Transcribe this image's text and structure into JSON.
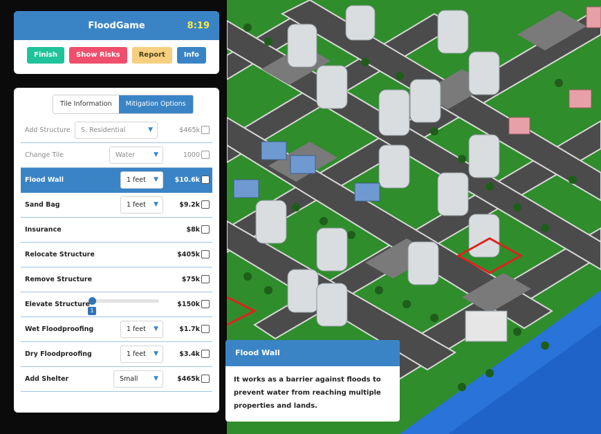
{
  "app": {
    "title": "FloodGame",
    "timer": "8:19"
  },
  "toolbar": {
    "finish": "Finish",
    "show_risks": "Show Risks",
    "report": "Report",
    "info": "Info"
  },
  "tabs": {
    "tile_info": "Tile Information",
    "mitigation": "Mitigation Options"
  },
  "rows": {
    "add_structure": {
      "label": "Add Structure",
      "select": "S. Residential",
      "price": "$465k"
    },
    "change_tile": {
      "label": "Change Tile",
      "select": "Water",
      "price": "1000"
    },
    "flood_wall": {
      "label": "Flood Wall",
      "select": "1 feet",
      "price": "$10.6k"
    },
    "sand_bag": {
      "label": "Sand Bag",
      "select": "1 feet",
      "price": "$9.2k"
    },
    "insurance": {
      "label": "Insurance",
      "price": "$8k"
    },
    "relocate": {
      "label": "Relocate Structure",
      "price": "$405k"
    },
    "remove": {
      "label": "Remove Structure",
      "price": "$75k"
    },
    "elevate": {
      "label": "Elevate Structure",
      "slider_value": "1",
      "price": "$150k"
    },
    "wet": {
      "label": "Wet Floodproofing",
      "select": "1 feet",
      "price": "$1.7k"
    },
    "dry": {
      "label": "Dry Floodproofing",
      "select": "1 feet",
      "price": "$3.4k"
    },
    "shelter": {
      "label": "Add Shelter",
      "select": "Small",
      "price": "$465k"
    }
  },
  "tooltip": {
    "title": "Flood Wall",
    "text": "It works as a barrier against floods to prevent water from reaching multiple properties and lands."
  },
  "colors": {
    "accent": "#3a84c6",
    "finish": "#1fc39a",
    "risks": "#ef4f6d",
    "report": "#f6cf7f",
    "timer": "#f7e948"
  }
}
